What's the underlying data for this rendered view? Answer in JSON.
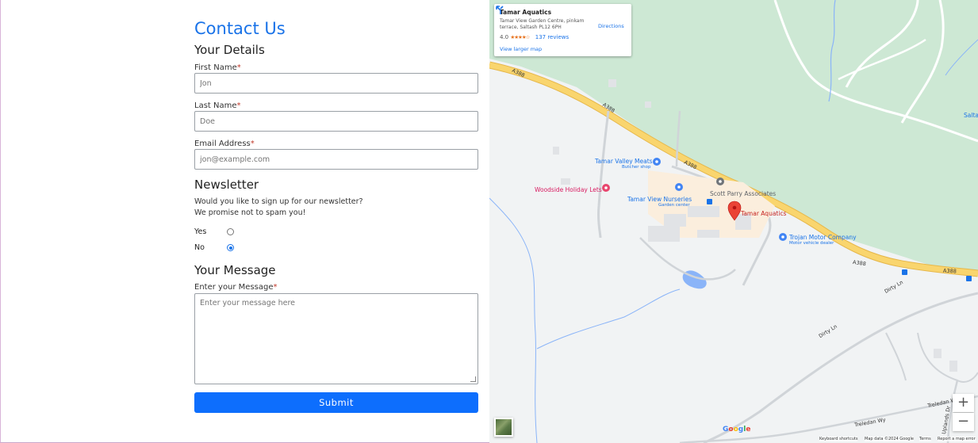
{
  "form": {
    "title": "Contact Us",
    "details_heading": "Your Details",
    "first_name": {
      "label": "First Name",
      "required": "*",
      "placeholder": "Jon"
    },
    "last_name": {
      "label": "Last Name",
      "required": "*",
      "placeholder": "Doe"
    },
    "email": {
      "label": "Email Address",
      "required": "*",
      "placeholder": "jon@example.com"
    },
    "newsletter_heading": "Newsletter",
    "newsletter_question": "Would you like to sign up for our newsletter?",
    "newsletter_note": "We promise not to spam you!",
    "options": [
      {
        "label": "Yes",
        "selected": false
      },
      {
        "label": "No",
        "selected": true
      }
    ],
    "message_heading": "Your Message",
    "message": {
      "label": "Enter your Message",
      "required": "*",
      "placeholder": "Enter your message here"
    },
    "submit_label": "Submit"
  },
  "map": {
    "card": {
      "name": "Tamar Aquatics",
      "address": "Tamar View Garden Centre, pinkam terrace, Saltash PL12 6PH",
      "rating": "4.0",
      "stars": "★★★★☆",
      "reviews": "137 reviews",
      "larger_map": "View larger map",
      "directions": "Directions"
    },
    "places": {
      "tamar_valley_meats": "Tamar Valley Meats",
      "butcher_shop": "Butcher shop",
      "woodside": "Woodside Holiday Lets",
      "nurseries": "Tamar View Nurseries",
      "garden_center": "Garden center",
      "scott_parry": "Scott Parry Associates",
      "tamar_aquatics": "Tamar Aquatics",
      "trojan": "Trojan Motor Company",
      "vehicle_dealer": "Motor vehicle dealer",
      "salta": "Salta"
    },
    "roads": {
      "a388_1": "A388",
      "a388_2": "A388",
      "a388_3": "A388",
      "a388_4": "A388",
      "a388_5": "A388",
      "dirty_ln_1": "Dirty Ln",
      "dirty_ln_2": "Dirty Ln",
      "treledan_wy_1": "Treledan Wy",
      "treledan_wy_2": "Treledan Wy",
      "uplands_dr": "Uplands Dr"
    },
    "zoom_in": "+",
    "zoom_out": "−",
    "google": "Google",
    "footer": {
      "shortcuts": "Keyboard shortcuts",
      "data": "Map data ©2024 Google",
      "terms": "Terms",
      "report": "Report a map error"
    },
    "colors": {
      "road": "#f9d56e",
      "road_edge": "#e6b74a",
      "water": "#8ab4f8",
      "park": "#cde8d4",
      "pin": "#ea4335",
      "brand": "#1a73e8"
    }
  }
}
